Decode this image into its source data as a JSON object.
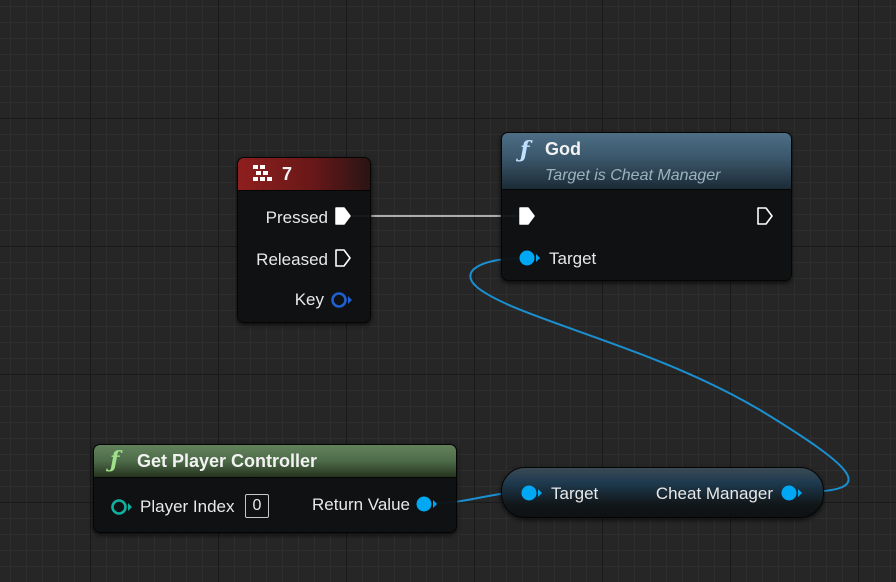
{
  "key_event_node": {
    "title": "7",
    "header_color": "#8f1f1f",
    "icon": "keyboard-icon",
    "pins": {
      "pressed": "Pressed",
      "released": "Released",
      "key": "Key"
    }
  },
  "god_node": {
    "title": "God",
    "subtitle": "Target is Cheat Manager",
    "header_color": "#3c5a70",
    "icon": "function-icon",
    "pins": {
      "target": "Target"
    }
  },
  "get_player_controller_node": {
    "title": "Get Player Controller",
    "header_color": "#4f6b4a",
    "icon": "function-icon",
    "pins": {
      "player_index": "Player Index",
      "player_index_value": "0",
      "return_value": "Return Value"
    }
  },
  "cheat_manager_node": {
    "pins": {
      "target": "Target",
      "cheat_manager": "Cheat Manager"
    }
  },
  "colors": {
    "object_pin": "#00a8f4",
    "struct_pin": "#10b0a0",
    "exec_wire": "#e6e6e6",
    "key_pin": "#1f5fd0"
  }
}
